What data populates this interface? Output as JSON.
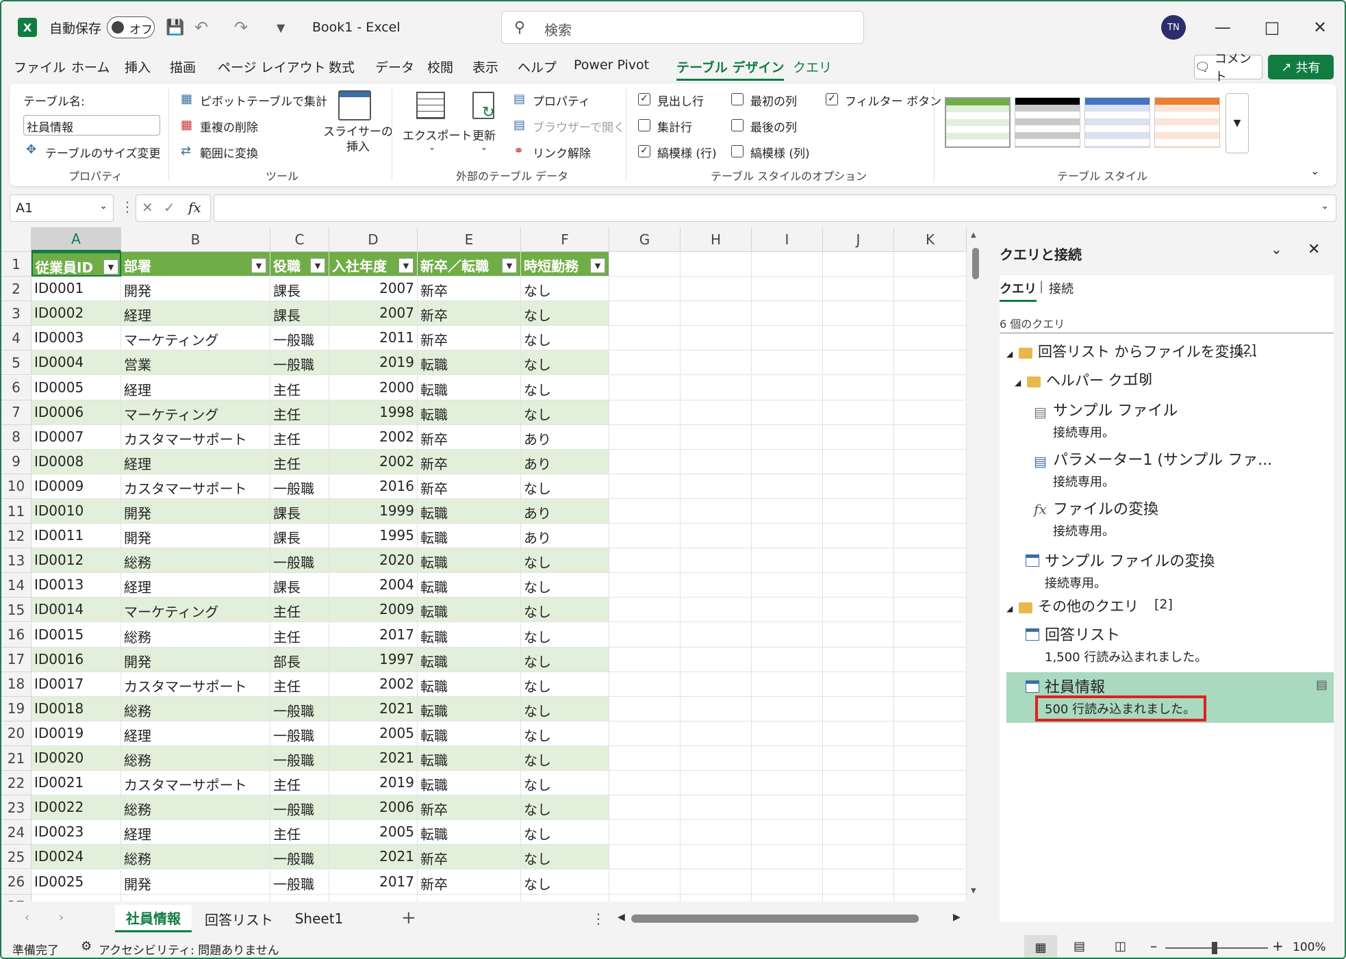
{
  "titlebar": {
    "autosave_label": "自動保存",
    "toggle_label": "オフ",
    "doc_title": "Book1  -  Excel",
    "search_placeholder": "検索",
    "avatar": "TN"
  },
  "menu": [
    "ファイル",
    "ホーム",
    "挿入",
    "描画",
    "ページ レイアウト",
    "数式",
    "データ",
    "校閲",
    "表示",
    "ヘルプ",
    "Power Pivot",
    "テーブル デザイン",
    "クエリ"
  ],
  "menu_actions": {
    "comment": "コメント",
    "share": "共有"
  },
  "ribbon": {
    "properties": {
      "label": "テーブル名:",
      "table_name": "社員情報",
      "resize": "テーブルのサイズ変更",
      "group": "プロパティ"
    },
    "tools": {
      "pivot": "ピボットテーブルで集計",
      "remove_dup": "重複の削除",
      "convert": "範囲に変換",
      "slicer": "スライサーの\n挿入",
      "group": "ツール"
    },
    "external": {
      "export": "エクスポート",
      "refresh": "更新",
      "properties": "プロパティ",
      "open_browser": "ブラウザーで開く",
      "unlink": "リンク解除",
      "group": "外部のテーブル データ"
    },
    "style_options": {
      "header_row": "見出し行",
      "total_row": "集計行",
      "banded_rows": "縞模様 (行)",
      "first_col": "最初の列",
      "last_col": "最後の列",
      "banded_cols": "縞模様 (列)",
      "filter_btn": "フィルター ボタン",
      "group": "テーブル スタイルのオプション"
    },
    "styles": {
      "group": "テーブル スタイル"
    }
  },
  "formula": {
    "namebox": "A1",
    "fx": "fx"
  },
  "columns": [
    "A",
    "B",
    "C",
    "D",
    "E",
    "F",
    "G",
    "H",
    "I",
    "J",
    "K"
  ],
  "table_headers": [
    "従業員ID",
    "部署",
    "役職",
    "入社年度",
    "新卒／転職",
    "時短勤務"
  ],
  "rows": [
    [
      "ID0001",
      "開発",
      "課長",
      "2007",
      "新卒",
      "なし"
    ],
    [
      "ID0002",
      "経理",
      "課長",
      "2007",
      "新卒",
      "なし"
    ],
    [
      "ID0003",
      "マーケティング",
      "一般職",
      "2011",
      "新卒",
      "なし"
    ],
    [
      "ID0004",
      "営業",
      "一般職",
      "2019",
      "転職",
      "なし"
    ],
    [
      "ID0005",
      "経理",
      "主任",
      "2000",
      "転職",
      "なし"
    ],
    [
      "ID0006",
      "マーケティング",
      "主任",
      "1998",
      "転職",
      "なし"
    ],
    [
      "ID0007",
      "カスタマーサポート",
      "主任",
      "2002",
      "新卒",
      "あり"
    ],
    [
      "ID0008",
      "経理",
      "主任",
      "2002",
      "新卒",
      "あり"
    ],
    [
      "ID0009",
      "カスタマーサポート",
      "一般職",
      "2016",
      "新卒",
      "なし"
    ],
    [
      "ID0010",
      "開発",
      "課長",
      "1999",
      "転職",
      "あり"
    ],
    [
      "ID0011",
      "開発",
      "課長",
      "1995",
      "転職",
      "あり"
    ],
    [
      "ID0012",
      "総務",
      "一般職",
      "2020",
      "転職",
      "なし"
    ],
    [
      "ID0013",
      "経理",
      "課長",
      "2004",
      "転職",
      "なし"
    ],
    [
      "ID0014",
      "マーケティング",
      "主任",
      "2009",
      "転職",
      "なし"
    ],
    [
      "ID0015",
      "総務",
      "主任",
      "2017",
      "転職",
      "なし"
    ],
    [
      "ID0016",
      "開発",
      "部長",
      "1997",
      "転職",
      "なし"
    ],
    [
      "ID0017",
      "カスタマーサポート",
      "主任",
      "2002",
      "転職",
      "なし"
    ],
    [
      "ID0018",
      "総務",
      "一般職",
      "2021",
      "転職",
      "なし"
    ],
    [
      "ID0019",
      "経理",
      "一般職",
      "2005",
      "転職",
      "なし"
    ],
    [
      "ID0020",
      "総務",
      "一般職",
      "2021",
      "転職",
      "なし"
    ],
    [
      "ID0021",
      "カスタマーサポート",
      "主任",
      "2019",
      "転職",
      "なし"
    ],
    [
      "ID0022",
      "総務",
      "一般職",
      "2006",
      "新卒",
      "なし"
    ],
    [
      "ID0023",
      "経理",
      "主任",
      "2005",
      "転職",
      "なし"
    ],
    [
      "ID0024",
      "総務",
      "一般職",
      "2021",
      "新卒",
      "なし"
    ],
    [
      "ID0025",
      "開発",
      "一般職",
      "2017",
      "新卒",
      "なし"
    ]
  ],
  "sheets": [
    "社員情報",
    "回答リスト",
    "Sheet1"
  ],
  "status": {
    "ready": "準備完了",
    "accessibility": "アクセシビリティ: 問題ありません",
    "zoom": "100%"
  },
  "pane": {
    "title": "クエリと接続",
    "tab_queries": "クエリ",
    "tab_connections": "接続",
    "count": "6 個のクエリ",
    "group1": "回答リスト からファイルを変換...",
    "group1_count": "[2]",
    "group2": "ヘルパー クエリ",
    "group2_count": "[3]",
    "q1": "サンプル ファイル",
    "q1_sub": "接続専用。",
    "q2": "パラメーター1 (サンプル ファ...",
    "q2_sub": "接続専用。",
    "q3": "ファイルの変換",
    "q3_sub": "接続専用。",
    "q4": "サンプル ファイルの変換",
    "q4_sub": "接続専用。",
    "group3": "その他のクエリ",
    "group3_count": "[2]",
    "q5": "回答リスト",
    "q5_sub": "1,500 行読み込まれました。",
    "q6": "社員情報",
    "q6_sub": "500 行読み込まれました。"
  },
  "colors": {
    "accent": "#107c41",
    "table_header": "#70ad47",
    "band": "#e2efda",
    "selected_query": "#a9d9bf",
    "highlight_box": "#e02020"
  }
}
